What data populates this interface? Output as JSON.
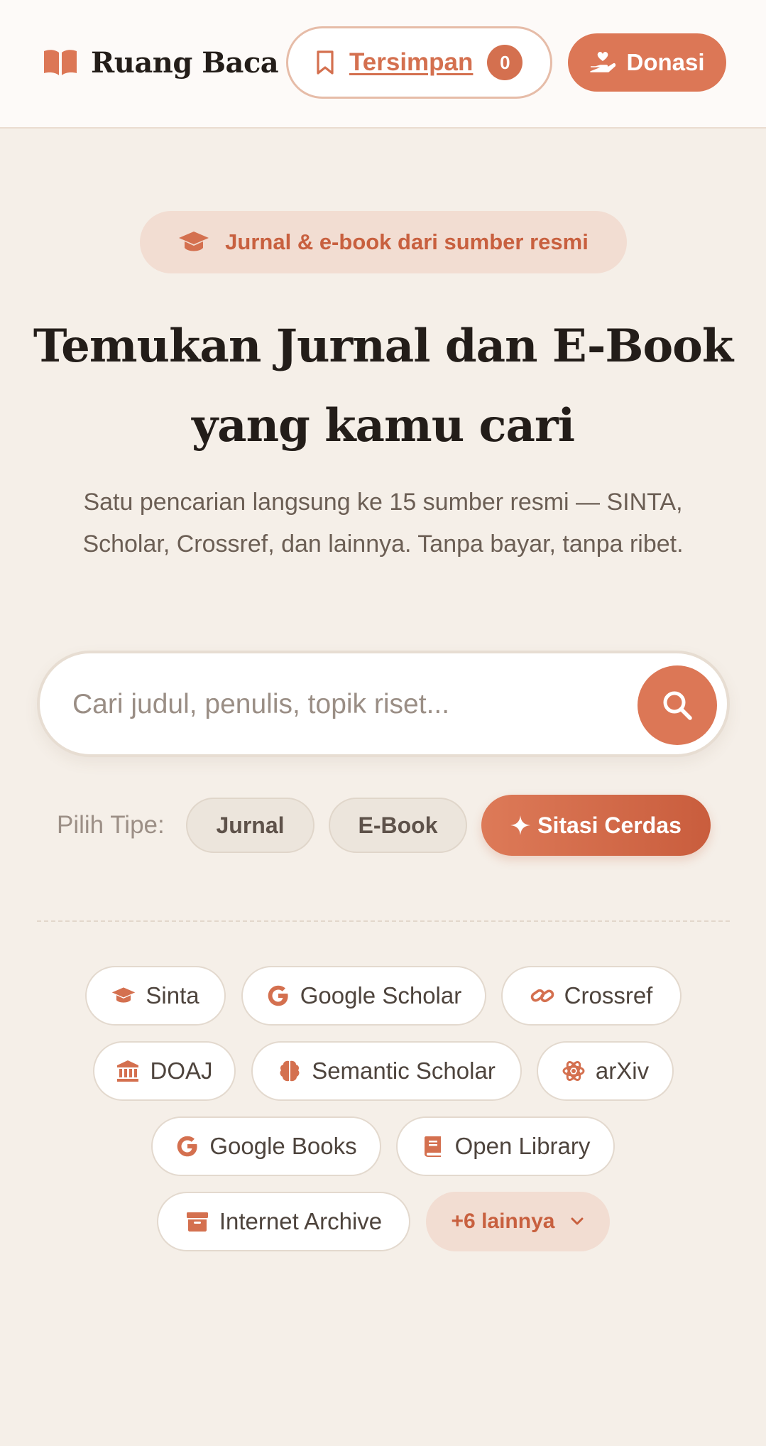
{
  "header": {
    "brand_name": "Ruang Baca",
    "brand_icon": "open-book-icon",
    "saved_label": "Tersimpan",
    "saved_count": "0",
    "donate_label": "Donasi",
    "accent_color": "#dc7756"
  },
  "hero": {
    "badge": "Jurnal & e-book dari sumber resmi",
    "title_line1": "Temukan Jurnal dan E-Book",
    "title_line2": "yang kamu cari",
    "subtitle": "Satu pencarian langsung ke 15 sumber resmi — SINTA, Scholar, Crossref, dan lainnya. Tanpa bayar, tanpa ribet."
  },
  "search": {
    "placeholder": "Cari judul, penulis, topik riset...",
    "value": ""
  },
  "type_filter": {
    "label": "Pilih Tipe:",
    "options": [
      "Jurnal",
      "E-Book"
    ],
    "smart_label": "Sitasi Cerdas"
  },
  "sources": [
    {
      "label": "Sinta",
      "icon": "graduation-cap-icon"
    },
    {
      "label": "Google Scholar",
      "icon": "google-icon"
    },
    {
      "label": "Crossref",
      "icon": "link-icon"
    },
    {
      "label": "DOAJ",
      "icon": "institution-icon"
    },
    {
      "label": "Semantic Scholar",
      "icon": "brain-icon"
    },
    {
      "label": "arXiv",
      "icon": "atom-icon"
    },
    {
      "label": "Google Books",
      "icon": "google-icon"
    },
    {
      "label": "Open Library",
      "icon": "book-icon"
    },
    {
      "label": "Internet Archive",
      "icon": "archive-box-icon"
    }
  ],
  "more_sources": "+6 lainnya"
}
